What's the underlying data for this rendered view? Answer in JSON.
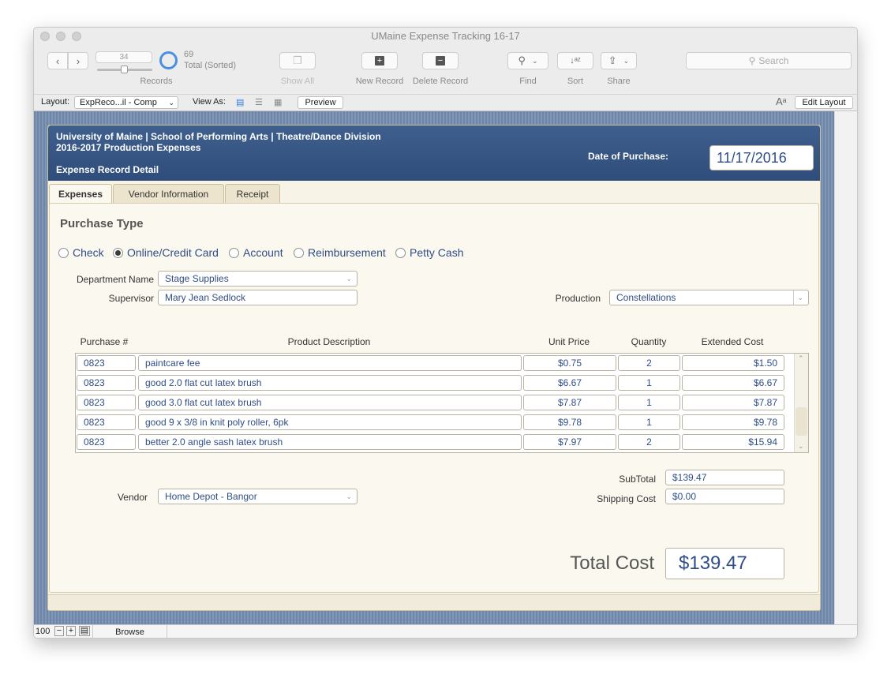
{
  "window": {
    "title": "UMaine Expense Tracking 16-17"
  },
  "toolbar": {
    "record_number": "34",
    "found_count": "69",
    "found_status": "Total (Sorted)",
    "records_label": "Records",
    "show_all": "Show All",
    "new_record": "New Record",
    "delete_record": "Delete Record",
    "find": "Find",
    "sort": "Sort",
    "share": "Share",
    "search_placeholder": "Search"
  },
  "layoutbar": {
    "layout_label": "Layout:",
    "layout_value": "ExpReco...il - Comp",
    "view_as_label": "View As:",
    "preview": "Preview",
    "edit_layout": "Edit Layout",
    "text_size_icon": "Aᵃ"
  },
  "header": {
    "line1": "University of Maine | School of Performing Arts | Theatre/Dance Division",
    "line2": "2016-2017 Production Expenses",
    "line3": "Expense Record Detail",
    "date_label": "Date of Purchase:",
    "date_value": "11/17/2016"
  },
  "tabs": [
    {
      "label": "Expenses",
      "active": true
    },
    {
      "label": "Vendor Information",
      "active": false
    },
    {
      "label": "Receipt",
      "active": false
    }
  ],
  "purchase_type": {
    "heading": "Purchase Type",
    "options": [
      "Check",
      "Online/Credit Card",
      "Account",
      "Reimbursement",
      "Petty Cash"
    ],
    "selected": "Online/Credit Card"
  },
  "form": {
    "department_label": "Department Name",
    "department_value": "Stage Supplies",
    "supervisor_label": "Supervisor",
    "supervisor_value": "Mary Jean Sedlock",
    "production_label": "Production",
    "production_value": "Constellations",
    "vendor_label": "Vendor",
    "vendor_value": "Home Depot - Bangor"
  },
  "items": {
    "columns": [
      "Purchase #",
      "Product Description",
      "Unit Price",
      "Quantity",
      "Extended Cost"
    ],
    "rows": [
      {
        "po": "0823",
        "desc": "paintcare fee",
        "price": "$0.75",
        "qty": "2",
        "ext": "$1.50"
      },
      {
        "po": "0823",
        "desc": "good 2.0 flat cut latex brush",
        "price": "$6.67",
        "qty": "1",
        "ext": "$6.67"
      },
      {
        "po": "0823",
        "desc": "good 3.0 flat cut latex brush",
        "price": "$7.87",
        "qty": "1",
        "ext": "$7.87"
      },
      {
        "po": "0823",
        "desc": "good 9 x 3/8 in knit poly roller, 6pk",
        "price": "$9.78",
        "qty": "1",
        "ext": "$9.78"
      },
      {
        "po": "0823",
        "desc": "better 2.0 angle sash latex brush",
        "price": "$7.97",
        "qty": "2",
        "ext": "$15.94"
      }
    ]
  },
  "totals": {
    "subtotal_label": "SubTotal",
    "subtotal_value": "$139.47",
    "shipping_label": "Shipping Cost",
    "shipping_value": "$0.00",
    "total_label": "Total Cost",
    "total_value": "$139.47"
  },
  "status": {
    "zoom": "100",
    "mode": "Browse"
  }
}
